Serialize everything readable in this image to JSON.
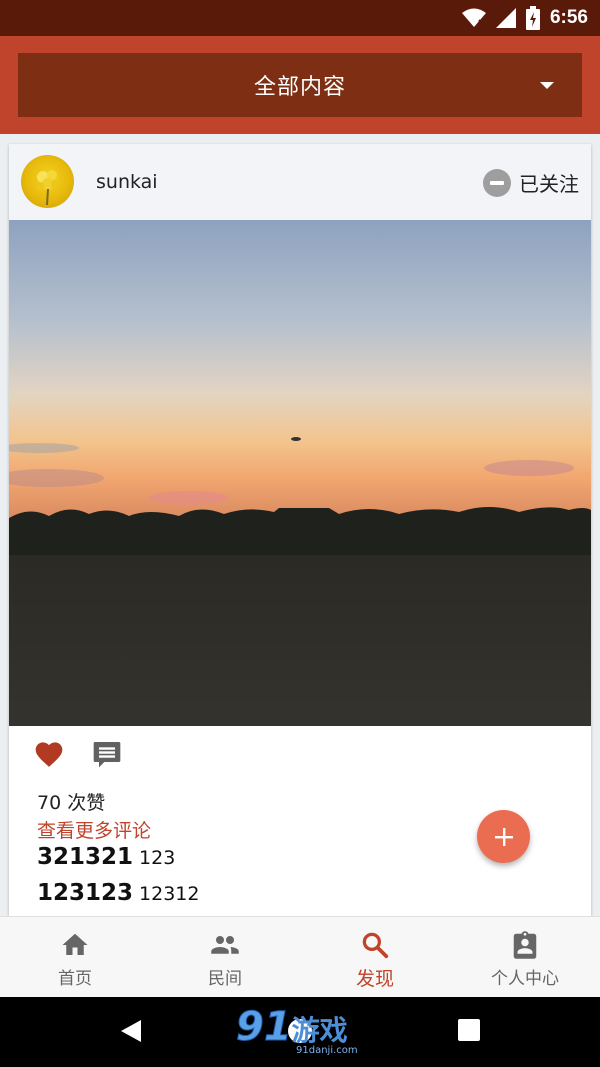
{
  "status_bar": {
    "time": "6:56"
  },
  "filter": {
    "label": "全部内容"
  },
  "post": {
    "username": "sunkai",
    "follow_label": "已关注",
    "likes_text": "70 次赞",
    "view_more_label": "查看更多评论",
    "comments": [
      {
        "author": "321321",
        "text": "123"
      },
      {
        "author": "123123",
        "text": "12312"
      }
    ]
  },
  "nav": {
    "items": [
      {
        "label": "首页",
        "icon": "home-icon"
      },
      {
        "label": "民间",
        "icon": "people-icon"
      },
      {
        "label": "发现",
        "icon": "search-icon"
      },
      {
        "label": "个人中心",
        "icon": "contact-icon"
      }
    ],
    "active_index": 2
  },
  "watermark": {
    "brand": "91",
    "brand_cn": "游戏",
    "url": "91danji.com"
  },
  "colors": {
    "primary": "#c0442c",
    "primary_dark": "#7e2f13",
    "status_bar": "#5a1a0a",
    "fab": "#ea6d51",
    "like": "#b23a22"
  }
}
